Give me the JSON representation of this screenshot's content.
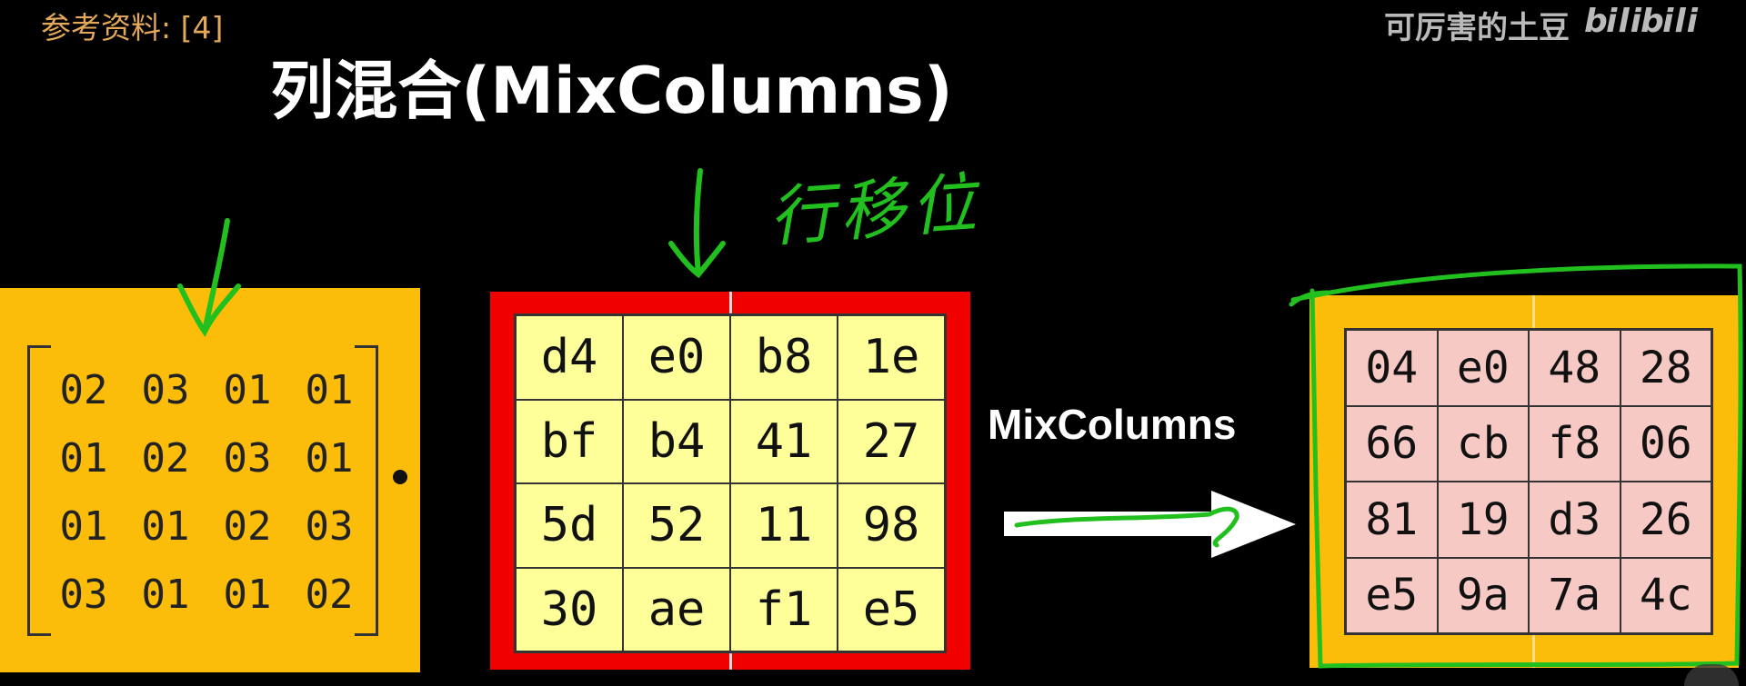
{
  "reference": "参考资料: [4]",
  "watermark": {
    "author": "可厉害的土豆",
    "logo_text": "bilibili"
  },
  "title": "列混合(MixColumns)",
  "handwritten_note": "行移位",
  "arrow_label": "MixColumns",
  "coefficient_matrix": [
    [
      "02",
      "03",
      "01",
      "01"
    ],
    [
      "01",
      "02",
      "03",
      "01"
    ],
    [
      "01",
      "01",
      "02",
      "03"
    ],
    [
      "03",
      "01",
      "01",
      "02"
    ]
  ],
  "input_state": [
    [
      "d4",
      "e0",
      "b8",
      "1e"
    ],
    [
      "bf",
      "b4",
      "41",
      "27"
    ],
    [
      "5d",
      "52",
      "11",
      "98"
    ],
    [
      "30",
      "ae",
      "f1",
      "e5"
    ]
  ],
  "output_state": [
    [
      "04",
      "e0",
      "48",
      "28"
    ],
    [
      "66",
      "cb",
      "f8",
      "06"
    ],
    [
      "81",
      "19",
      "d3",
      "26"
    ],
    [
      "e5",
      "9a",
      "7a",
      "4c"
    ]
  ],
  "colors": {
    "background": "#000000",
    "panel_yellow": "#fbbd0a",
    "input_border_red": "#f10000",
    "input_cell": "#ffff99",
    "output_cell": "#f6c9c4",
    "annotation_green": "#22c01f",
    "reference_text": "#e3a85a"
  }
}
